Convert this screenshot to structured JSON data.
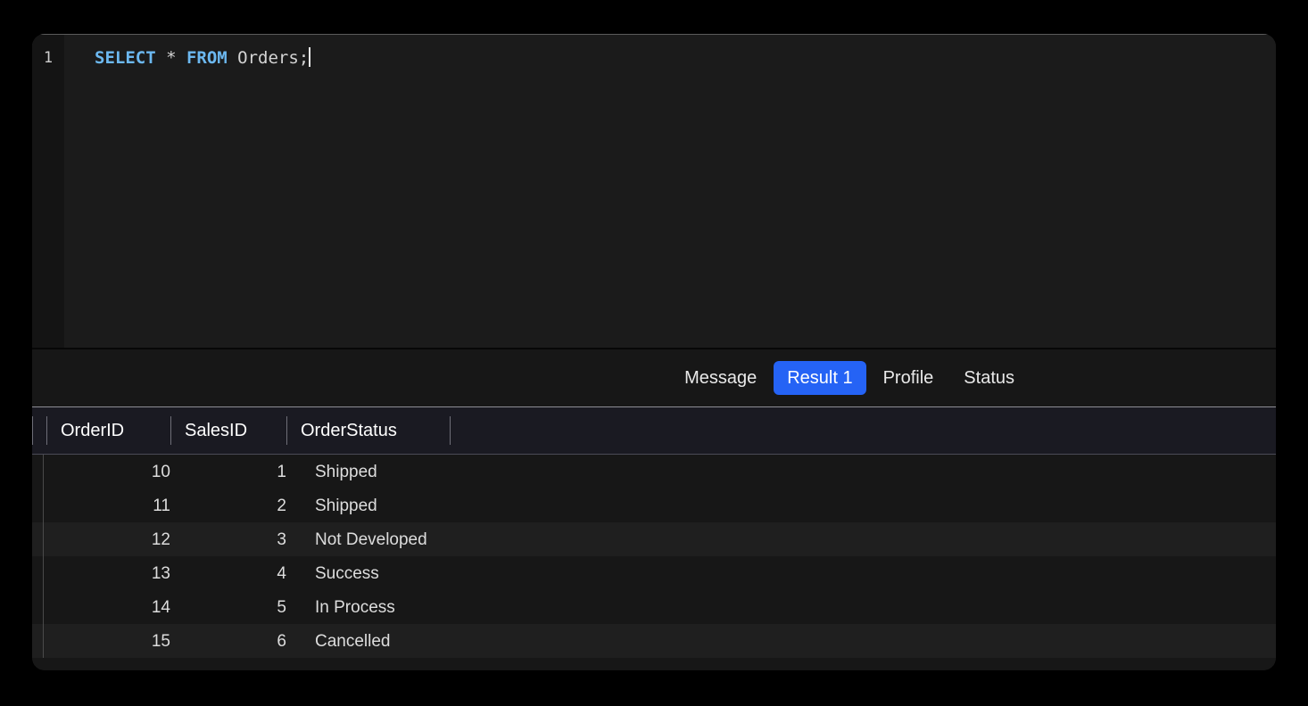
{
  "editor": {
    "line_number": "1",
    "sql_tokens": [
      {
        "text": "SELECT",
        "type": "keyword"
      },
      {
        "text": " * ",
        "type": "operator"
      },
      {
        "text": "FROM",
        "type": "keyword"
      },
      {
        "text": " Orders;",
        "type": "identifier"
      }
    ],
    "sql_text": "SELECT * FROM Orders;",
    "cursor_visible": true
  },
  "result_tabs": {
    "items": [
      {
        "label": "Message",
        "active": false
      },
      {
        "label": "Result 1",
        "active": true
      },
      {
        "label": "Profile",
        "active": false
      },
      {
        "label": "Status",
        "active": false
      }
    ],
    "active_label": "Result 1"
  },
  "result_grid": {
    "columns": [
      {
        "label": "OrderID",
        "align": "right"
      },
      {
        "label": "SalesID",
        "align": "right"
      },
      {
        "label": "OrderStatus",
        "align": "left"
      }
    ],
    "rows": [
      {
        "OrderID": "10",
        "SalesID": "1",
        "OrderStatus": "Shipped",
        "highlighted": false
      },
      {
        "OrderID": "11",
        "SalesID": "2",
        "OrderStatus": "Shipped",
        "highlighted": false
      },
      {
        "OrderID": "12",
        "SalesID": "3",
        "OrderStatus": "Not Developed",
        "highlighted": true
      },
      {
        "OrderID": "13",
        "SalesID": "4",
        "OrderStatus": "Success",
        "highlighted": false
      },
      {
        "OrderID": "14",
        "SalesID": "5",
        "OrderStatus": "In Process",
        "highlighted": false
      },
      {
        "OrderID": "15",
        "SalesID": "6",
        "OrderStatus": "Cancelled",
        "highlighted": true
      }
    ],
    "row_count": 6
  },
  "colors": {
    "page_background": "#000000",
    "window_background": "#171717",
    "editor_background": "#1b1b1b",
    "editor_gutter": "#141414",
    "keyword": "#6cb8f0",
    "code_text": "#d4d4d4",
    "tab_active": "#2563f5",
    "grid_header_background": "#1a1a22",
    "row_background": "#171717",
    "row_highlight": "#1f1f1f"
  }
}
